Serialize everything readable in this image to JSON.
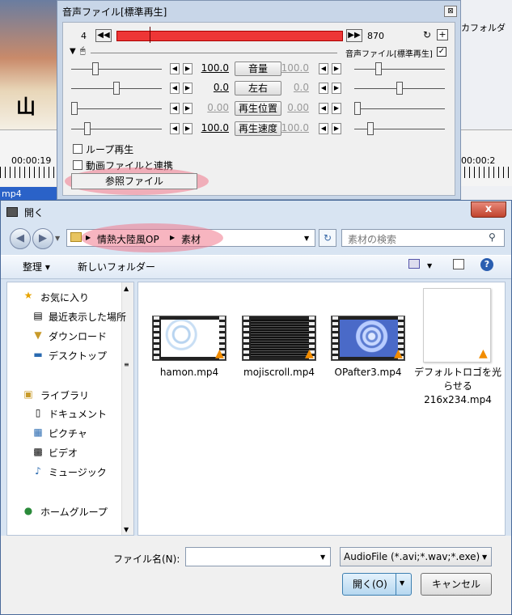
{
  "background": {
    "left_image_text": "山",
    "timecode": "00:00:19",
    "timecode_right": "00:00:2",
    "file_label": "mp4",
    "right_text": "カフォルダ"
  },
  "audio_window": {
    "title": "音声ファイル[標準再生]",
    "close_glyph": "⊠",
    "frame_start": "4",
    "frame_end": "870",
    "layer_label": "音声ファイル[標準再生]",
    "params": [
      {
        "left_value": "100.0",
        "label": "音量",
        "right_value": "100.0",
        "thumb_pct": 0.25,
        "right_thumb_pct": 0.25,
        "enabled": true
      },
      {
        "left_value": "0.0",
        "label": "左右",
        "right_value": "0.0",
        "thumb_pct": 0.5,
        "right_thumb_pct": 0.5,
        "enabled": true
      },
      {
        "left_value": "0.00",
        "label": "再生位置",
        "right_value": "0.00",
        "thumb_pct": 0.0,
        "right_thumb_pct": 0.0,
        "enabled": false
      },
      {
        "left_value": "100.0",
        "label": "再生速度",
        "right_value": "100.0",
        "thumb_pct": 0.15,
        "right_thumb_pct": 0.15,
        "enabled": true
      }
    ],
    "loop_label": "ループ再生",
    "link_label": "動画ファイルと連携",
    "ref_button": "参照ファイル",
    "highlight_color": "#f07a8c"
  },
  "dialog": {
    "title": "開く",
    "close": "x",
    "address": {
      "segments": [
        "情熱大陸風OP",
        "素材"
      ]
    },
    "search_placeholder": "素材の検索",
    "toolbar": {
      "organize": "整理 ▾",
      "new_folder": "新しいフォルダー"
    },
    "nav": {
      "favorites": "お気に入り",
      "fav_items": [
        "最近表示した場所",
        "ダウンロード",
        "デスクトップ"
      ],
      "libraries": "ライブラリ",
      "lib_items": [
        "ドキュメント",
        "ピクチャ",
        "ビデオ",
        "ミュージック"
      ],
      "homegroup": "ホームグループ"
    },
    "files": [
      {
        "name": "hamon.mp4",
        "style": "hamon"
      },
      {
        "name": "mojiscroll.mp4",
        "style": "moji"
      },
      {
        "name": "OPafter3.mp4",
        "style": "opafter"
      },
      {
        "name": "デフォルトロゴを光らせる216x234.mp4",
        "style": "blank"
      }
    ],
    "filename_label": "ファイル名(N):",
    "filename_value": "",
    "filter_label": "AudioFile (*.avi;*.wav;*.exe)",
    "open_button": "開く(O)",
    "cancel_button": "キャンセル"
  }
}
